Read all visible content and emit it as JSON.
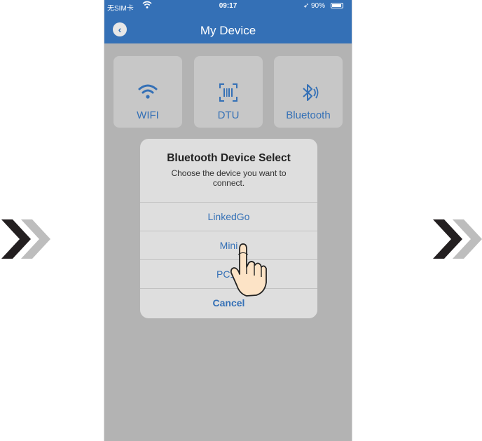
{
  "status_bar": {
    "carrier": "无SIM卡",
    "time": "09:17",
    "battery": "90%"
  },
  "header": {
    "title": "My Device",
    "back_icon": "chevron-left-icon"
  },
  "device_types": [
    {
      "label": "WIFI",
      "icon": "wifi-icon"
    },
    {
      "label": "DTU",
      "icon": "barcode-icon"
    },
    {
      "label": "Bluetooth",
      "icon": "bluetooth-icon"
    }
  ],
  "dialog": {
    "title": "Bluetooth Device Select",
    "message": "Choose the device you want to connect.",
    "options": [
      "LinkedGo",
      "Mini",
      "PC10"
    ],
    "cancel": "Cancel"
  },
  "colors": {
    "accent": "#3470b6",
    "overlay": "#b3b3b3",
    "dialog_bg": "#dedede",
    "arrow_dark": "#231f20",
    "arrow_light": "#bdbdbd"
  }
}
